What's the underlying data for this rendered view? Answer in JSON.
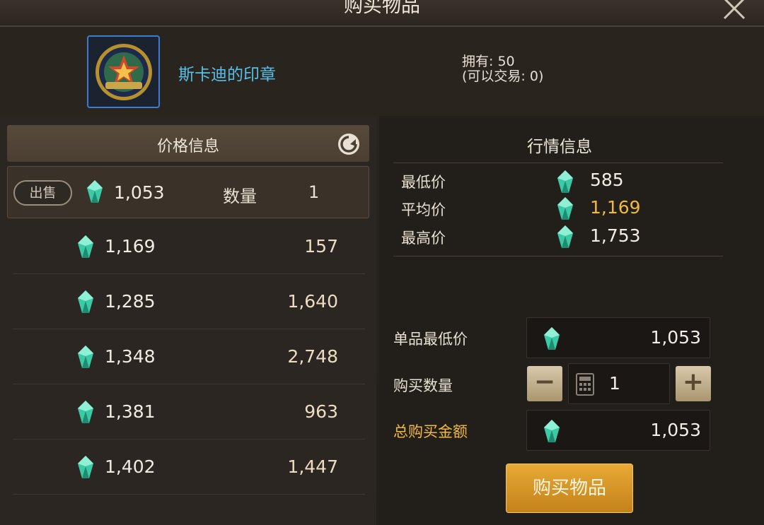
{
  "dialog": {
    "title": "购买物品"
  },
  "item": {
    "name": "斯卡迪的印章",
    "owned_line": "拥有: 50",
    "tradable_line": "(可以交易: 0)"
  },
  "price_panel": {
    "header": "价格信息",
    "sell_row": {
      "badge": "出售",
      "price": "1,053",
      "qty_label": "数量",
      "qty": "1"
    },
    "rows": [
      {
        "price": "1,169",
        "qty": "157"
      },
      {
        "price": "1,285",
        "qty": "1,640"
      },
      {
        "price": "1,348",
        "qty": "2,748"
      },
      {
        "price": "1,381",
        "qty": "963"
      },
      {
        "price": "1,402",
        "qty": "1,447"
      }
    ]
  },
  "market_panel": {
    "header": "行情信息",
    "min_label": "最低价",
    "min_value": "585",
    "avg_label": "平均价",
    "avg_value": "1,169",
    "max_label": "最高价",
    "max_value": "1,753"
  },
  "purchase_form": {
    "unit_min_label": "单品最低价",
    "unit_min_value": "1,053",
    "quantity_label": "购买数量",
    "quantity_value": "1",
    "minus_label": "−",
    "plus_label": "+",
    "total_label": "总购买金额",
    "total_value": "1,053",
    "buy_button": "购买物品"
  },
  "colors": {
    "accent_gold": "#f2b940",
    "item_name_blue": "#56c0e8",
    "gem_teal": "#3cc9a6"
  }
}
